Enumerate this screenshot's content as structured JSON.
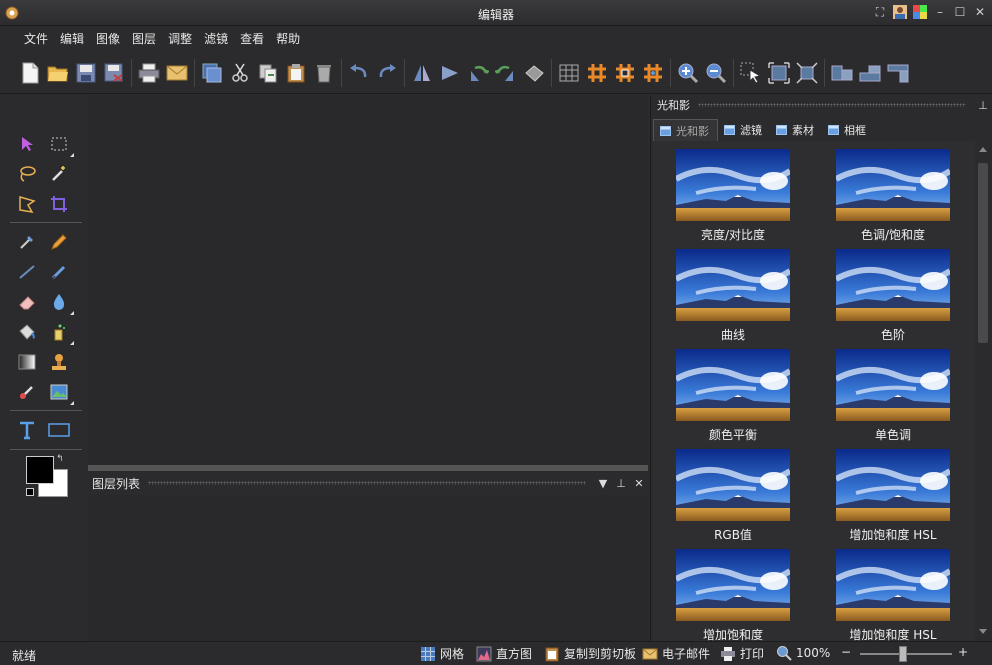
{
  "window": {
    "title": "编辑器"
  },
  "menu": [
    "文件",
    "编辑",
    "图像",
    "图层",
    "调整",
    "滤镜",
    "查看",
    "帮助"
  ],
  "toolbar": {
    "icons": [
      "new-file-icon",
      "open-folder-icon",
      "save-icon",
      "save-as-icon",
      "print-icon",
      "email-icon",
      "copy-layer-icon",
      "cut-icon",
      "copy-icon",
      "paste-icon",
      "clear-icon",
      "undo-icon",
      "redo-icon",
      "flip-horizontal-icon",
      "flip-vertical-icon",
      "rotate-left-icon",
      "rotate-right-icon",
      "rotate-free-icon",
      "grid-icon",
      "hash-grid-icon",
      "hash-grid-alt-icon",
      "hash-grid-blue-icon",
      "zoom-in-icon",
      "zoom-out-icon",
      "select-pointer-icon",
      "fit-window-icon",
      "actual-size-icon",
      "align-left-icon",
      "align-bottom-icon",
      "align-top-icon"
    ]
  },
  "tools": {
    "icons": [
      "select-arrow-icon",
      "rect-select-icon",
      "lasso-icon",
      "magic-wand-icon",
      "polygon-lasso-icon",
      "crop-icon",
      "eyedropper-icon",
      "pencil-icon",
      "line-icon",
      "brush-icon",
      "eraser-icon",
      "blur-drop-icon",
      "paint-bucket-icon",
      "spray-icon",
      "gradient-icon",
      "stamp-icon",
      "clone-brush-icon",
      "image-icon",
      "text-tool-icon",
      "rectangle-tool-icon"
    ],
    "foreground_color": "#000000",
    "background_color": "#ffffff"
  },
  "layers_panel": {
    "title": "图层列表"
  },
  "effects_panel": {
    "title": "光和影",
    "tabs": [
      "光和影",
      "滤镜",
      "素材",
      "相框"
    ],
    "active_tab": 0,
    "thumbnails": [
      "亮度/对比度",
      "色调/饱和度",
      "曲线",
      "色阶",
      "颜色平衡",
      "单色调",
      "RGB值",
      "增加饱和度 HSL",
      "增加饱和度",
      "增加饱和度 HSL"
    ]
  },
  "status": {
    "text": "就绪",
    "grid": "网格",
    "histogram": "直方图",
    "copy_clipboard": "复制到剪切板",
    "email": "电子邮件",
    "print": "打印",
    "zoom": "100%",
    "zoom_minus": "−",
    "zoom_plus": "+"
  },
  "colors": {
    "accent_orange": "#e8892a",
    "accent_blue": "#5a9ae0"
  }
}
